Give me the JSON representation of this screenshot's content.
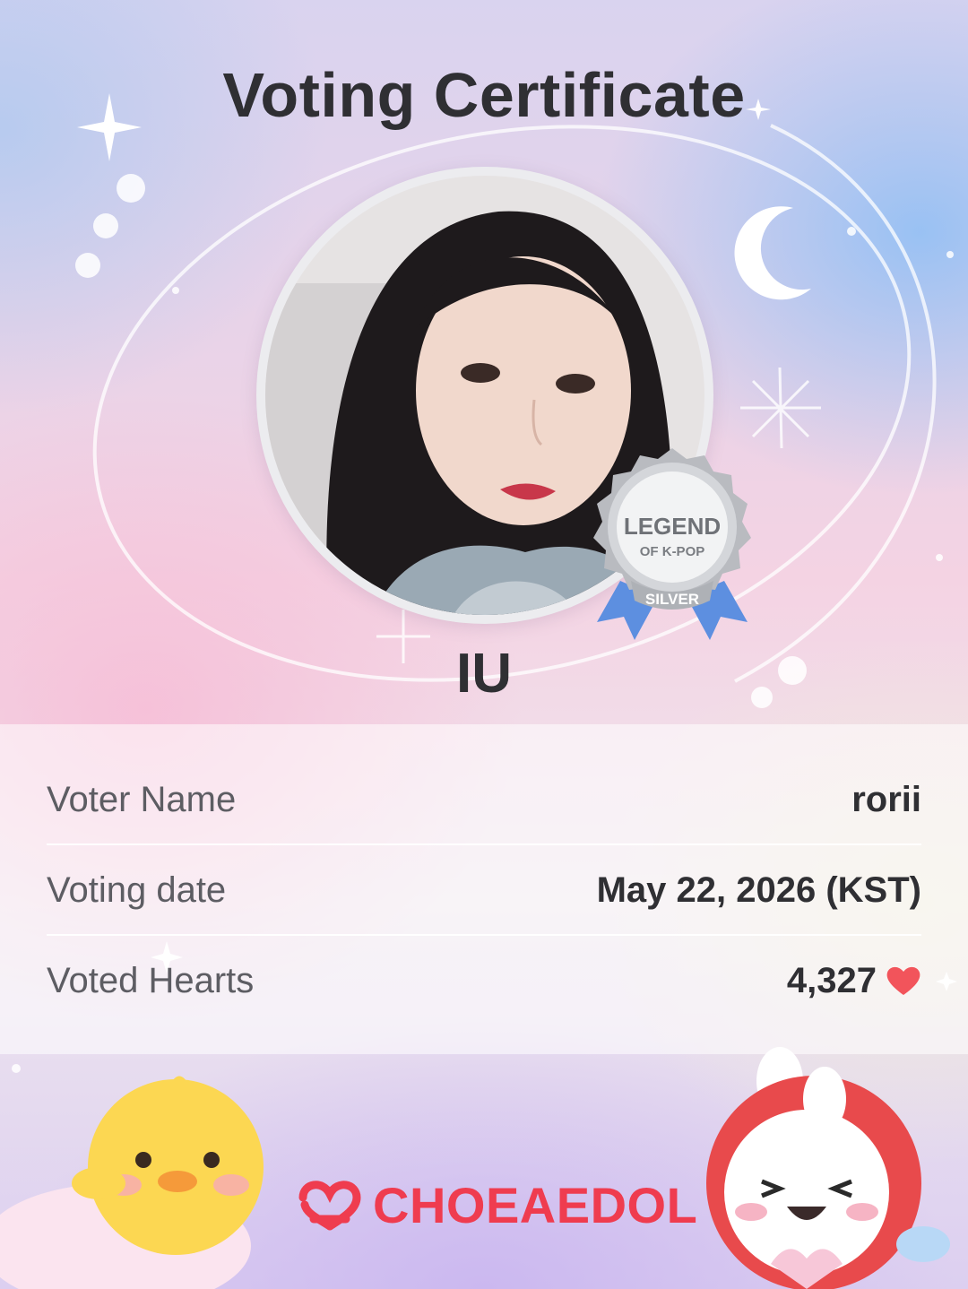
{
  "certificate": {
    "title": "Voting Certificate",
    "artist_name": "IU"
  },
  "badge": {
    "line1": "LEGEND",
    "line2": "OF K-POP",
    "tier": "SILVER"
  },
  "details": [
    {
      "label": "Voter Name",
      "value": "rorii"
    },
    {
      "label": "Voting date",
      "value": "May 22, 2026 (KST)"
    },
    {
      "label": "Voted Hearts",
      "value": "4,327"
    }
  ],
  "brand": {
    "name": "CHOEAEDOL"
  },
  "colors": {
    "brand": "#ef3c4f",
    "heart": "#f2545b",
    "text": "#2f2f33"
  },
  "icons": [
    "heart-icon",
    "choeaedol-logo-icon",
    "moon-icon",
    "sparkle-icon",
    "legend-badge-icon"
  ]
}
